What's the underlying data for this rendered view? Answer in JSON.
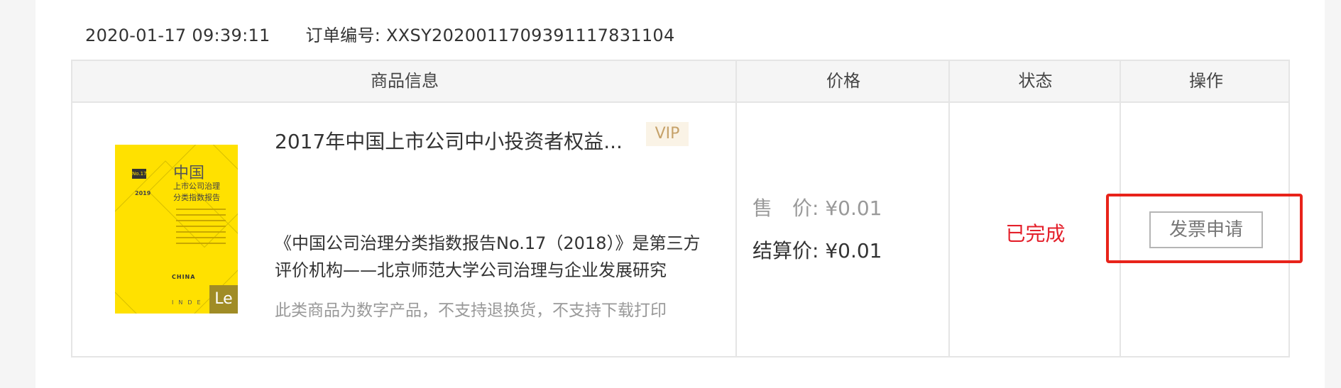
{
  "order": {
    "date": "2020-01-17 09:39:11",
    "order_label": "订单编号: XXSY202001170939111783110 4"
  },
  "table": {
    "headers": {
      "product": "商品信息",
      "price": "价格",
      "status": "状态",
      "action": "操作"
    }
  },
  "product": {
    "title": "2017年中国上市公司中小投资者权益...",
    "vip": "VIP",
    "description": "《中国公司治理分类指数报告No.17（2018）》是第三方评价机构——北京师范大学公司治理与企业发展研究",
    "note": "此类商品为数字产品，不支持退换货，不支持下载打印",
    "cover": {
      "badge": "No.17",
      "year": "2019",
      "zh": "中国",
      "line1": "上市公司治理",
      "line2": "分类指数报告",
      "en": "CHINA",
      "inde": "INDE",
      "logo": "Le"
    }
  },
  "price": {
    "sale": "售　价: ¥0.01",
    "settle": "结算价: ¥0.01"
  },
  "status": {
    "text": "已完成",
    "color": "#e4202b"
  },
  "action": {
    "invoice_label": "发票申请",
    "highlight_color": "#e8231a"
  }
}
